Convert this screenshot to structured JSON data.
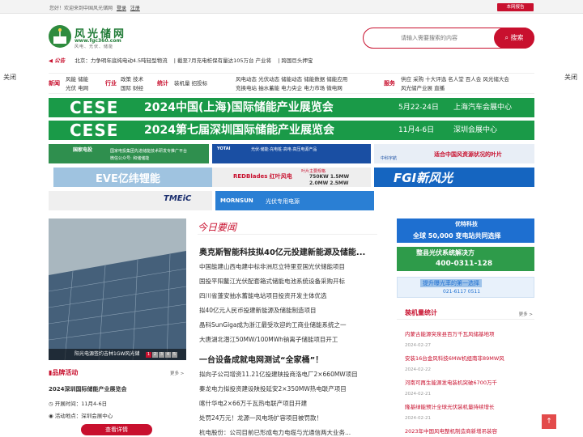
{
  "topbar": {
    "welcome": "您好！欢迎来到中国风光储网",
    "login": "登录",
    "register": "注册",
    "report": "本网报告"
  },
  "logo": {
    "name": "风光储网",
    "url": "www.fgc360.com",
    "slogan": "风电、光伏、储能"
  },
  "search": {
    "placeholder": "请输入需要搜索的内容",
    "button": "搜索"
  },
  "notice": {
    "label": "公告",
    "items": [
      "北京：力争明年底纯电动4.5吨轻型物流",
      "截至7月充电桩保有量达105万台 产业将",
      "跨国巨头押宝"
    ]
  },
  "close_left": "关闭",
  "close_right": "关闭",
  "nav": {
    "g1": {
      "title": "新闻",
      "row1": "风能 储能",
      "row2": "光伏 电网"
    },
    "g2": {
      "title": "行业",
      "row1": "政策 技术",
      "row2": "国际 财经"
    },
    "g3": {
      "title": "统计",
      "row1": "装机量 招投标",
      "row2": ""
    },
    "g4": {
      "row1": "风电动态 光伏动态 储能动态 储能数据 储能应用",
      "row2": "充换电站 抽水蓄能 电力央企 电力市场 微电网"
    },
    "g5": {
      "title": "服务",
      "row1": "供应 采购 十大评选 名人堂 百人会 风光储大会",
      "row2": "风光储产业展 直播"
    }
  },
  "banners": [
    {
      "cese": "CESE",
      "title": "2024中国(上海)国际储能产业展览会",
      "date": "5月22-24日",
      "place": "上海汽车会展中心"
    },
    {
      "cese": "CESE",
      "title": "2024第七届深圳国际储能产业展览会",
      "date": "11月4-6日",
      "place": "深圳会展中心"
    }
  ],
  "ads": {
    "a1": "国家电投",
    "a1b": "国家电投集团先进储能技术研发专推广平台",
    "a1c": "微信公众号: 和储储能",
    "a2": "光伏·储能·充电桩·高电·高压电源产品",
    "a2b": "YOTAI",
    "a3": "中科宇航",
    "a3b": "适合中国风资源状况的叶片",
    "a4": "EVE亿纬锂能",
    "a5": "REDBlades 红叶风电",
    "a5b": "叶片主要规格",
    "a5c": "750KW 1.5MW",
    "a5d": "2.0MW 2.5MW",
    "a6": "FGI新风光",
    "a7": "TMEiC",
    "a8": "MORNSUN",
    "a8b": "光伏专用电源"
  },
  "slide": {
    "caption": "阳光电源签约吉林1GW风光储",
    "dots": [
      "1",
      "2",
      "3",
      "4",
      "5"
    ]
  },
  "brand": {
    "title": "品牌活动",
    "more": "更多 >",
    "event": "2024深圳国际储能产业展览会",
    "time_label": "开展时间：",
    "time": "11月4-6日",
    "place_label": "活动地点：",
    "place": "深圳会展中心",
    "button": "查看详情"
  },
  "today": {
    "title": "今日要闻",
    "headline1": "奥克斯智能科技拟40亿元投建新能源及储能...",
    "list1": [
      "中国能建山西电建中标非洲厄立特里亚国光伏储能项目",
      "国投平阳鳌江光伏配套箱式储能电池系统设备采购开标",
      "四川省蓬安抽水蓄能电站项目投资开发主体优选",
      "拟40亿元人民币投建新能源及储能制造项目",
      "晶科SunGiga成为浙江最受欢迎的工商业储能系统之一",
      "大唐湖北潜江50MW/100MWh钠离子储能项目开工"
    ],
    "headline2": "一台设备成就电网测试“全家桶”！",
    "list2": [
      "拟向子公司增资11.21亿投建陕投商洛电厂2×660MW项目",
      "秦龙电力拟投资建设陕投延安2×350MW热电联产项目",
      "喀什华电2×66万千瓦热电联产项目开建",
      "处罚24万元！龙源一风电场扩容项目被罚款！",
      "杭电股份：公司目前已形成电力电缆与光通信两大业务..."
    ]
  },
  "right_ads": {
    "r1": "优特科技",
    "r1b": "全球 50,000 变电站共同选择",
    "r2": "整县光伏系统解决方",
    "r2b": "400-0311-128",
    "r3": "提升曝光率的第一选择",
    "r3b": "021-6117 0511"
  },
  "stats": {
    "title": "装机量统计",
    "more": "更多 >",
    "items": [
      {
        "title": "内蒙古能源突泉县百万千瓦风储基地项",
        "date": "2024-02-27"
      },
      {
        "title": "安装16台金风科技6MW机组南非89MW风",
        "date": "2024-02-22"
      },
      {
        "title": "河南可再生能源发电装机突破6700万千",
        "date": "2024-02-21"
      },
      {
        "title": "隆基绿能预计全球光伏装机量持续增长",
        "date": "2024-02-21"
      },
      {
        "title": "2023年中国风电整机制造商新增吊装容",
        "date": ""
      }
    ]
  },
  "totop": "↑"
}
